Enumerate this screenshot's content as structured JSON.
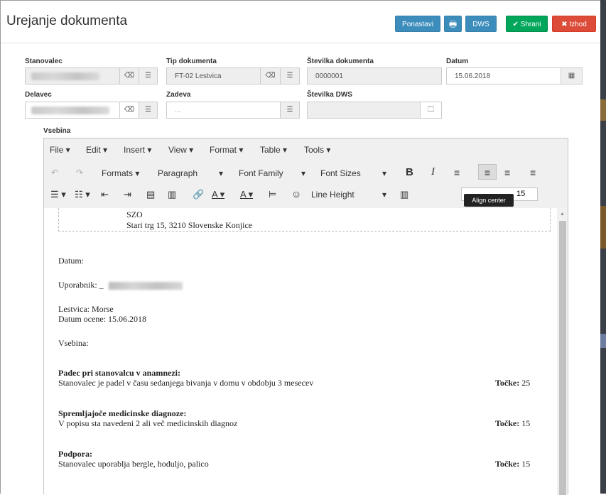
{
  "header": {
    "title": "Urejanje dokumenta",
    "buttons": {
      "reset": "Ponastavi",
      "dws": "DWS",
      "save": "✔ Shrani",
      "exit": "✖ Izhod"
    }
  },
  "form": {
    "stanovalec_label": "Stanovalec",
    "tip_label": "Tip dokumenta",
    "tip_value": "FT-02 Lestvica",
    "stevilka_label": "Številka dokumenta",
    "stevilka_value": "0000001",
    "datum_label": "Datum",
    "datum_value": "15.06.2018",
    "delavec_label": "Delavec",
    "zadeva_label": "Zadeva",
    "zadeva_placeholder": "...",
    "dws_label": "Številka DWS",
    "vsebina_label": "Vsebina"
  },
  "editor": {
    "menu": [
      "File ▾",
      "Edit ▾",
      "Insert ▾",
      "View ▾",
      "Format ▾",
      "Table ▾",
      "Tools ▾"
    ],
    "toolbar": {
      "formats": "Formats ▾",
      "paragraph": "Paragraph",
      "font_family": "Font Family",
      "font_sizes": "Font Sizes",
      "line_height": "Line Height",
      "size_value": "15",
      "tooltip": "Align center"
    },
    "content": {
      "org": "SZO",
      "address": "Stari trg 15, 3210 Slovenske Konjice",
      "datum": "Datum:",
      "uporabnik": "Uporabnik: _",
      "lestvica": "Lestvica: Morse",
      "datum_ocene": "Datum ocene: 15.06.2018",
      "vsebina": "Vsebina:",
      "points_label": "Točke:",
      "sections": [
        {
          "heading": "Padec pri stanovalcu v anamnezi:",
          "text": "Stanovalec je padel v času sedanjega bivanja v domu v obdobju 3 mesecev",
          "points": "25"
        },
        {
          "heading": "Spremljajoče medicinske diagnoze:",
          "text": "V popisu sta navedeni 2 ali več medicinskih diagnoz",
          "points": "15"
        },
        {
          "heading": "Podpora:",
          "text": "Stanovalec uporablja bergle, hoduljo, palico",
          "points": "15"
        }
      ]
    }
  }
}
